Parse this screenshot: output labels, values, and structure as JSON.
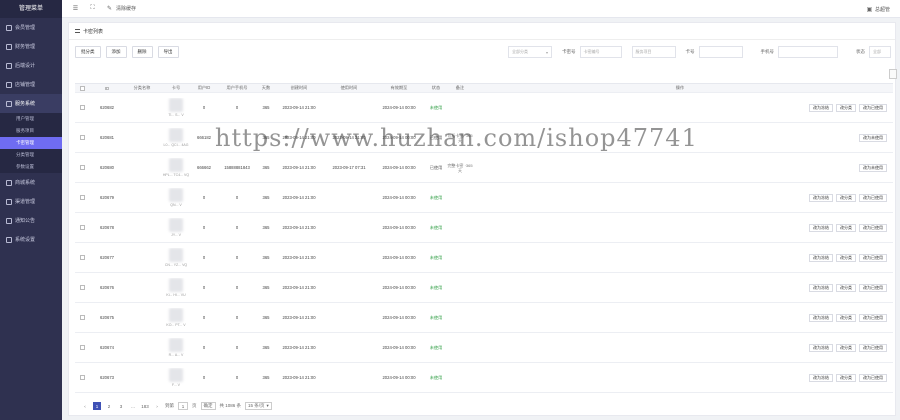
{
  "sidebar": {
    "title": "管理菜单",
    "items": [
      {
        "label": "会员管理",
        "icon": "user-icon"
      },
      {
        "label": "财务管理",
        "icon": "wallet-icon"
      },
      {
        "label": "后端设计",
        "icon": "design-icon"
      },
      {
        "label": "店铺管理",
        "icon": "store-icon"
      },
      {
        "label": "服务系统",
        "icon": "service-icon",
        "open": true
      }
    ],
    "sub_items": [
      {
        "label": "用户管理",
        "active": false
      },
      {
        "label": "服务项目",
        "active": false
      },
      {
        "label": "卡密管理",
        "active": true
      },
      {
        "label": "分类管理",
        "active": false
      },
      {
        "label": "参数设置",
        "active": false
      }
    ],
    "items_after": [
      {
        "label": "商城系统",
        "icon": "mall-icon"
      },
      {
        "label": "渠道管理",
        "icon": "channel-icon"
      },
      {
        "label": "通知公告",
        "icon": "notice-icon"
      },
      {
        "label": "系统设置",
        "icon": "settings-icon"
      }
    ]
  },
  "topbar": {
    "clear_cache": "清除缓存",
    "admin": "总超管"
  },
  "panel": {
    "title": "卡密列表"
  },
  "toolbar": {
    "buttons": [
      "批分类",
      "添加",
      "删除",
      "导出"
    ]
  },
  "filters": {
    "category_placeholder": "全部分类",
    "card_label": "卡密号",
    "card_placeholder": "卡密编号",
    "project_placeholder": "服务项目",
    "cardno_label": "卡号",
    "phone_label": "手机号",
    "status_label": "状态",
    "status_placeholder": "全部"
  },
  "table": {
    "headers": [
      "ID",
      "分类名称",
      "卡号",
      "用户ID",
      "用户手机号",
      "天数",
      "创建时间",
      "使用时间",
      "有效期至",
      "状态",
      "备注",
      "操作"
    ],
    "rows": [
      {
        "id": "620682",
        "card": "Tl... S... V",
        "uid": "0",
        "phone": "0",
        "days": "365",
        "created": "2023-09-14 21:00",
        "used": "",
        "expire": "2024-09-14 00:00",
        "status": "未使用",
        "note": "",
        "ops": [
          "改为冻结",
          "改分类",
          "改为已使用"
        ]
      },
      {
        "id": "620681",
        "card": "L0... QCI... 4AG",
        "uid": "666182",
        "phone": "",
        "days": "365",
        "created": "2023-09-14 21:00",
        "used": "2023-09-14 21:00",
        "expire": "2024-09-14 00:00",
        "status": "已使用",
        "note": "包括卡密 ·365天",
        "ops": [
          "改为未使用"
        ]
      },
      {
        "id": "620680",
        "card": "HPL... TC4... VQ",
        "uid": "666662",
        "phone": "15888881843",
        "days": "365",
        "created": "2023-09-14 21:00",
        "used": "2023-09-17 07:31",
        "expire": "2024-09-14 00:00",
        "status": "已使用",
        "note": "完整卡密 ·365天",
        "ops": [
          "改为未使用"
        ]
      },
      {
        "id": "620679",
        "card": "QN... V",
        "uid": "0",
        "phone": "0",
        "days": "365",
        "created": "2023-09-14 21:00",
        "used": "",
        "expire": "2024-09-14 00:00",
        "status": "未使用",
        "note": "",
        "ops": [
          "改为冻结",
          "改分类",
          "改为已使用"
        ]
      },
      {
        "id": "620678",
        "card": "JY... V",
        "uid": "0",
        "phone": "0",
        "days": "365",
        "created": "2023-09-14 21:00",
        "used": "",
        "expire": "2024-09-14 00:00",
        "status": "未使用",
        "note": "",
        "ops": [
          "改为冻结",
          "改分类",
          "改为已使用"
        ]
      },
      {
        "id": "620677",
        "card": "CN... YZ... VQ",
        "uid": "0",
        "phone": "0",
        "days": "365",
        "created": "2023-09-14 21:00",
        "used": "",
        "expire": "2024-09-14 00:00",
        "status": "未使用",
        "note": "",
        "ops": [
          "改为冻结",
          "改分类",
          "改为已使用"
        ]
      },
      {
        "id": "620676",
        "card": "Ki... HI... VU",
        "uid": "0",
        "phone": "0",
        "days": "365",
        "created": "2023-09-14 21:00",
        "used": "",
        "expire": "2024-09-14 00:00",
        "status": "未使用",
        "note": "",
        "ops": [
          "改为冻结",
          "改分类",
          "改为已使用"
        ]
      },
      {
        "id": "620675",
        "card": "KO... PT... V",
        "uid": "0",
        "phone": "0",
        "days": "365",
        "created": "2023-09-14 21:00",
        "used": "",
        "expire": "2024-09-14 00:00",
        "status": "未使用",
        "note": "",
        "ops": [
          "改为冻结",
          "改分类",
          "改为已使用"
        ]
      },
      {
        "id": "620674",
        "card": "R... A... V",
        "uid": "0",
        "phone": "0",
        "days": "365",
        "created": "2023-09-14 21:00",
        "used": "",
        "expire": "2024-09-14 00:00",
        "status": "未使用",
        "note": "",
        "ops": [
          "改为冻结",
          "改分类",
          "改为已使用"
        ]
      },
      {
        "id": "620673",
        "card": "F... V",
        "uid": "0",
        "phone": "0",
        "days": "365",
        "created": "2023-09-14 21:00",
        "used": "",
        "expire": "2024-09-14 00:00",
        "status": "未使用",
        "note": "",
        "ops": [
          "改为冻结",
          "改分类",
          "改为已使用"
        ]
      }
    ]
  },
  "pager": {
    "prev": "‹",
    "pages": [
      "1",
      "2",
      "3",
      "...",
      "183"
    ],
    "next": "›",
    "goto_label": "到第",
    "goto_value": "1",
    "page_unit": "页",
    "confirm": "确定",
    "total": "共 1086 条",
    "page_size": "15 条/页"
  },
  "watermark": "https://www.huzhan.com/ishop47741",
  "colors": {
    "sidebar_bg": "#2f3150",
    "active_sub": "#6f6cf2",
    "unused_status": "#2f9e44",
    "pager_active": "#3f51b5"
  }
}
